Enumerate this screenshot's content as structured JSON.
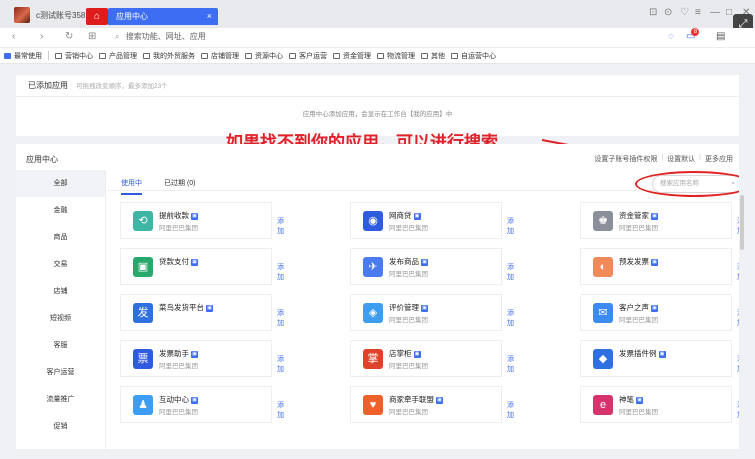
{
  "titlebar": {
    "tab_label": "c测试账号358",
    "active_tab": "应用中心",
    "close": "×",
    "controls": [
      "⊡",
      "⊙",
      "♡",
      "≡",
      "—",
      "□",
      "✕"
    ]
  },
  "addressbar": {
    "back": "‹",
    "forward": "›",
    "reload": "↻",
    "grid": "⊞",
    "search_icon": "🔍",
    "placeholder": "搜索功能、网址、应用",
    "notify_count": "8"
  },
  "bookmarks": [
    {
      "label": "最常使用",
      "accent": true
    },
    {
      "label": "营销中心"
    },
    {
      "label": "产品管理"
    },
    {
      "label": "我的外贸服务"
    },
    {
      "label": "店铺管理"
    },
    {
      "label": "资源中心"
    },
    {
      "label": "客户运营"
    },
    {
      "label": "资金管理"
    },
    {
      "label": "物流管理"
    },
    {
      "label": "其他"
    },
    {
      "label": "自运营中心"
    }
  ],
  "added": {
    "title": "已添加应用",
    "hint": "可拖拽改变顺序，最多添加23个",
    "empty": "应用中心添加应用，会显示在工作台【我的应用】中"
  },
  "annotation": "如果找不到你的应用，可以进行搜索",
  "main": {
    "title": "应用中心",
    "links": [
      "设置子账号插件权限",
      "设置默认",
      "更多应用"
    ],
    "tabs": [
      {
        "label": "使用中",
        "active": true
      },
      {
        "label": "已过期 (0)",
        "active": false
      }
    ],
    "search_placeholder": "搜索应用名称"
  },
  "sidebar": [
    {
      "label": "全部",
      "active": true
    },
    {
      "label": "金融"
    },
    {
      "label": "商品"
    },
    {
      "label": "交易"
    },
    {
      "label": "店铺"
    },
    {
      "label": "短视频"
    },
    {
      "label": "客服"
    },
    {
      "label": "客户运营"
    },
    {
      "label": "流量推广"
    },
    {
      "label": "促销"
    }
  ],
  "cards": [
    {
      "name": "提前收款",
      "company": "阿里巴巴集团",
      "add": "添加",
      "icon": "⟲",
      "color": "#3fb5a5",
      "tag": true
    },
    {
      "name": "网商贷",
      "company": "阿里巴巴集团",
      "add": "添加",
      "icon": "◉",
      "color": "#2f5be0",
      "tag": true
    },
    {
      "name": "资金管家",
      "company": "阿里巴巴集团",
      "add": "添加",
      "icon": "♚",
      "color": "#8a8f99",
      "tag": true
    },
    {
      "name": "贷款支付",
      "company": "",
      "add": "添加",
      "icon": "▣",
      "color": "#29a86b",
      "tag": true
    },
    {
      "name": "发布商品",
      "company": "阿里巴巴集团",
      "add": "添加",
      "icon": "✈",
      "color": "#4a7cf0",
      "tag": true
    },
    {
      "name": "预发发票",
      "company": "",
      "add": "添加",
      "icon": "◐",
      "color": "#f08a5a",
      "tag": true
    },
    {
      "name": "菜鸟发货平台",
      "company": "",
      "add": "添加",
      "icon": "发",
      "color": "#2f6fe0",
      "tag": true
    },
    {
      "name": "评价管理",
      "company": "阿里巴巴集团",
      "add": "添加",
      "icon": "◈",
      "color": "#3d9df0",
      "tag": true
    },
    {
      "name": "客户之声",
      "company": "阿里巴巴集团",
      "add": "添加",
      "icon": "✉",
      "color": "#3d8af0",
      "tag": true
    },
    {
      "name": "发票助手",
      "company": "阿里巴巴集团",
      "add": "添加",
      "icon": "票",
      "color": "#2f5be0",
      "tag": true
    },
    {
      "name": "店掌柜",
      "company": "阿里巴巴集团",
      "add": "添加",
      "icon": "掌",
      "color": "#e0412a",
      "tag": true
    },
    {
      "name": "发票插件例",
      "company": "",
      "add": "添加",
      "icon": "◆",
      "color": "#2f6fe0",
      "tag": true
    },
    {
      "name": "互动中心",
      "company": "阿里巴巴集团",
      "add": "添加",
      "icon": "♟",
      "color": "#3d9df0",
      "tag": true
    },
    {
      "name": "商家牵手联盟",
      "company": "阿里巴巴集团",
      "add": "添加",
      "icon": "♥",
      "color": "#f0602a",
      "tag": true
    },
    {
      "name": "神笔",
      "company": "阿里巴巴集团",
      "add": "添加",
      "icon": "e",
      "color": "#d6336c",
      "tag": true
    }
  ]
}
